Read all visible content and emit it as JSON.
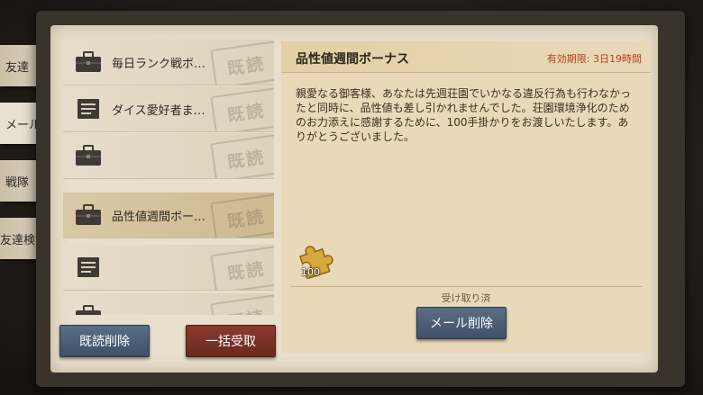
{
  "tabs": [
    {
      "label": "友達",
      "active": false
    },
    {
      "label": "メール",
      "active": true
    },
    {
      "label": "戦隊",
      "active": false
    },
    {
      "label": "友達検索",
      "active": false
    }
  ],
  "mail_list": [
    {
      "icon": "briefcase-icon",
      "title": "毎日ランク戦ボ…",
      "read_stamp": "既読",
      "active": false
    },
    {
      "icon": "document-icon",
      "title": "ダイス愛好者ま…",
      "read_stamp": "既読",
      "active": false
    },
    {
      "icon": "briefcase-icon",
      "title": "",
      "read_stamp": "既読",
      "active": false
    },
    {
      "icon": "briefcase-icon",
      "title": "品性値週間ボー…",
      "read_stamp": "既読",
      "active": true
    },
    {
      "icon": "document-icon",
      "title": "",
      "read_stamp": "既読",
      "active": false
    },
    {
      "icon": "briefcase-icon",
      "title": "",
      "read_stamp": "既読",
      "active": false
    }
  ],
  "detail": {
    "title": "品性値週間ボーナス",
    "expiry": "有効期限: 3日19時間",
    "body": "親愛なる御客様、あなたは先週荘園でいかなる違反行為も行わなかったと同時に、品性値も差し引かれませんでした。荘園環境浄化のためのお力添えに感謝するために、100手掛かりをお渡しいたします。ありがとうございました。",
    "reward": {
      "icon": "puzzle-piece-icon",
      "count": "100"
    },
    "claimed_text": "受け取り済",
    "delete_button": "メール削除"
  },
  "footer": {
    "delete_read_button": "既読削除",
    "claim_all_button": "一括受取"
  },
  "colors": {
    "accent_red": "#b3401f",
    "button_blue": "#4a5c75",
    "button_red": "#7a3226"
  }
}
